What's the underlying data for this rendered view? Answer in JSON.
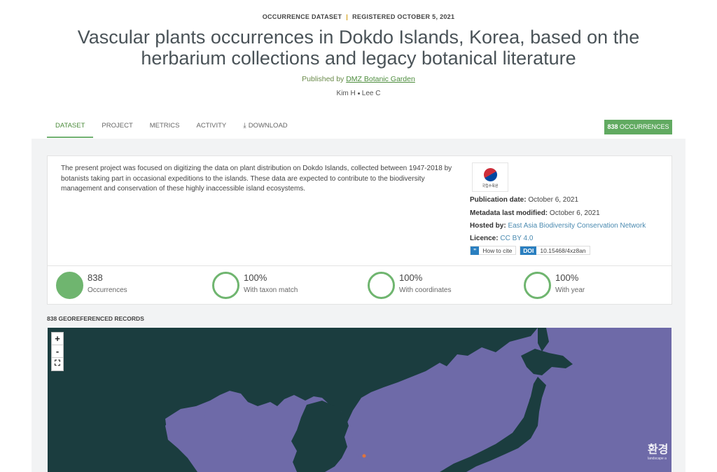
{
  "header": {
    "dataset_type": "OCCURRENCE DATASET",
    "registered": "REGISTERED OCTOBER 5, 2021",
    "title": "Vascular plants occurrences in Dokdo Islands, Korea, based on the herbarium collections and legacy botanical literature",
    "published_prefix": "Published by",
    "publisher": "DMZ Botanic Garden",
    "author_1": "Kim H",
    "author_2": "Lee C"
  },
  "tabs": [
    "DATASET",
    "PROJECT",
    "METRICS",
    "ACTIVITY",
    "DOWNLOAD"
  ],
  "occurrences_badge": {
    "count": "838",
    "label": "OCCURRENCES"
  },
  "description": "The present project was focused on digitizing the data on plant distribution on Dokdo Islands, collected between 1947-2018 by botanists taking part in occasional expeditions to the islands. These data are expected to contribute to the biodiversity management and conservation of these highly inaccessible island ecosystems.",
  "logo_text": "국립수목원",
  "meta": {
    "publication_label": "Publication date:",
    "publication_value": "October 6, 2021",
    "modified_label": "Metadata last modified:",
    "modified_value": "October 6, 2021",
    "hosted_label": "Hosted by:",
    "hosted_value": "East Asia Biodiversity Conservation Network",
    "licence_label": "Licence:",
    "licence_value": "CC BY 4.0",
    "cite_icon": "”",
    "cite_label": "How to cite",
    "doi_label": "DOI",
    "doi_value": "10.15468/4xz8an"
  },
  "metrics": [
    {
      "value": "838",
      "label": "Occurrences"
    },
    {
      "value": "100%",
      "label": "With taxon match"
    },
    {
      "value": "100%",
      "label": "With coordinates"
    },
    {
      "value": "100%",
      "label": "With year"
    }
  ],
  "georeferenced_label": "838 GEOREFERENCED RECORDS",
  "map": {
    "zoom_in": "+",
    "zoom_out": "-",
    "fullscreen": "⛶",
    "land_color": "#1b3d3f",
    "sea_color": "#6e6aa8",
    "point_color": "#e0743c"
  },
  "watermark": {
    "main": "환경",
    "sub": "landscape a"
  },
  "colors": {
    "accent_green": "#61aa61",
    "link_blue": "#4a8ab0"
  }
}
